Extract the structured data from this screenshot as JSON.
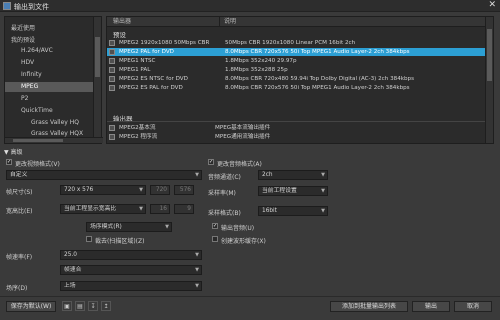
{
  "window": {
    "title": "输出到文件",
    "close": "✕"
  },
  "tree": {
    "items": [
      {
        "label": "最近使用"
      },
      {
        "label": "我的预设"
      },
      {
        "label": "H.264/AVC"
      },
      {
        "label": "HDV"
      },
      {
        "label": "Infinity"
      },
      {
        "label": "MPEG",
        "selected": true
      },
      {
        "label": "P2"
      },
      {
        "label": "QuickTime"
      },
      {
        "label": "Grass Valley HQ"
      },
      {
        "label": "Grass Valley HQX"
      }
    ]
  },
  "list": {
    "col_output": "输出器",
    "col_desc": "说明",
    "preset_section": "预设",
    "presets": [
      {
        "name": "MPEG2 1920x1080 50Mbps CBR",
        "desc": "50Mbps CBR 1920x1080 Linear PCM 16bit 2ch"
      },
      {
        "name": "MPEG2 PAL for DVD",
        "desc": "8.0Mbps CBR 720x576 50i Top MPEG1 Audio Layer-2 2ch 384kbps",
        "selected": true
      },
      {
        "name": "MPEG1 NTSC",
        "desc": "1.8Mbps 352x240 29.97p"
      },
      {
        "name": "MPEG1 PAL",
        "desc": "1.8Mbps 352x288 25p"
      },
      {
        "name": "MPEG2 ES NTSC for DVD",
        "desc": "8.0Mbps CBR 720x480 59.94i Top Dolby Digital (AC-3) 2ch 384kbps"
      },
      {
        "name": "MPEG2 ES PAL for DVD",
        "desc": "8.0Mbps CBR 720x576 50i Top MPEG1 Audio Layer-2 2ch 384kbps"
      }
    ],
    "output_section": "输出器",
    "outputs": [
      {
        "name": "MPEG2基本流",
        "desc": "MPEG基本流输出插件"
      },
      {
        "name": "MPEG2 程序流",
        "desc": "MPEG通用流输出插件"
      }
    ]
  },
  "settings": {
    "toggle": "▼ 高级",
    "video": {
      "enable": "更改视频格式(V)",
      "preset": "自定义",
      "frame_size_label": "帧尺寸(S)",
      "frame_size": "720 x 576",
      "w": "720",
      "h": "576",
      "aspect_label": "宽高比(E)",
      "aspect": "当前工程显示宽高比",
      "ax": "16",
      "ay": "9",
      "field_order": "场序模式(R)",
      "field_check": "裁去(扫描区域)(Z)",
      "rate_label": "帧速率(F)",
      "rate": "25.0",
      "rate_mode": "帧速合",
      "order_label": "场序(D)",
      "order": "上场"
    },
    "audio": {
      "enable": "更改音频格式(A)",
      "channels_label": "音频通道(C)",
      "channels": "2ch",
      "sample_label": "采样率(M)",
      "sample": "当前工程设置",
      "bits_label": "采样格式(B)",
      "bits": "16bit",
      "output_audio": "输出音频(U)",
      "proxy": "创建波形缓存(X)"
    }
  },
  "buttons": {
    "save_default": "保存为默认(W)",
    "add_batch": "添加到批量输出列表",
    "export": "输出",
    "cancel": "取消"
  }
}
